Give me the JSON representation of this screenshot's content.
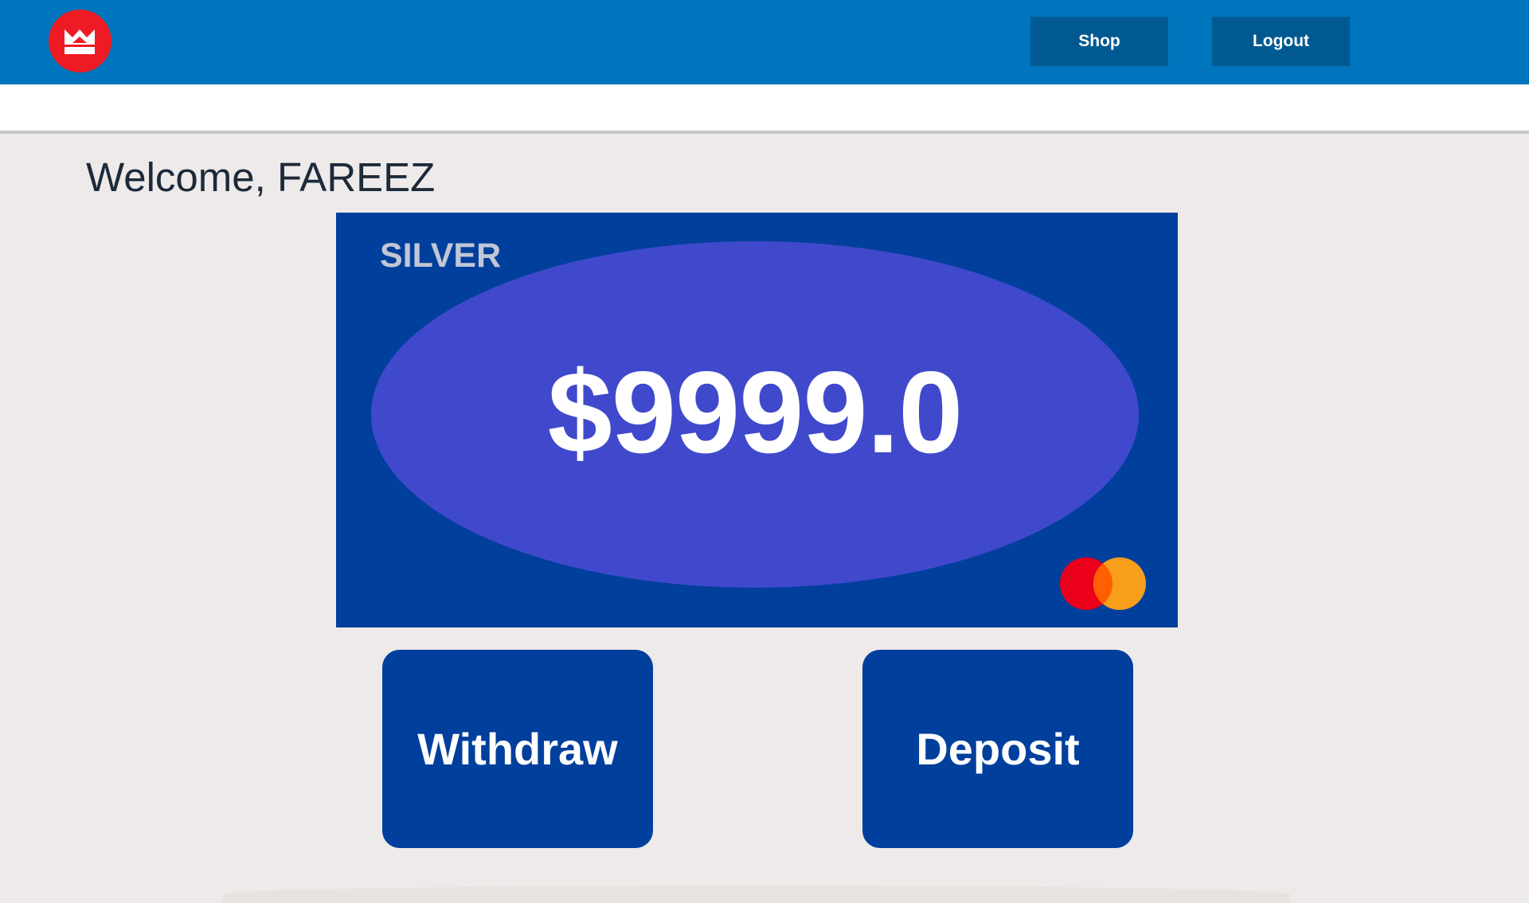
{
  "header": {
    "logo_icon": "bmo-logo-icon",
    "shop_label": "Shop",
    "logout_label": "Logout",
    "bar_color": "#0075be",
    "logo_color": "#ee1b24"
  },
  "main": {
    "welcome_text": "Welcome, FAREEZ",
    "card": {
      "tier": "SILVER",
      "balance": "$9999.0",
      "network_icon": "mastercard-icon",
      "card_color": "#003f9c",
      "oval_color": "#4049cc"
    },
    "actions": {
      "withdraw_label": "Withdraw",
      "deposit_label": "Deposit"
    }
  }
}
